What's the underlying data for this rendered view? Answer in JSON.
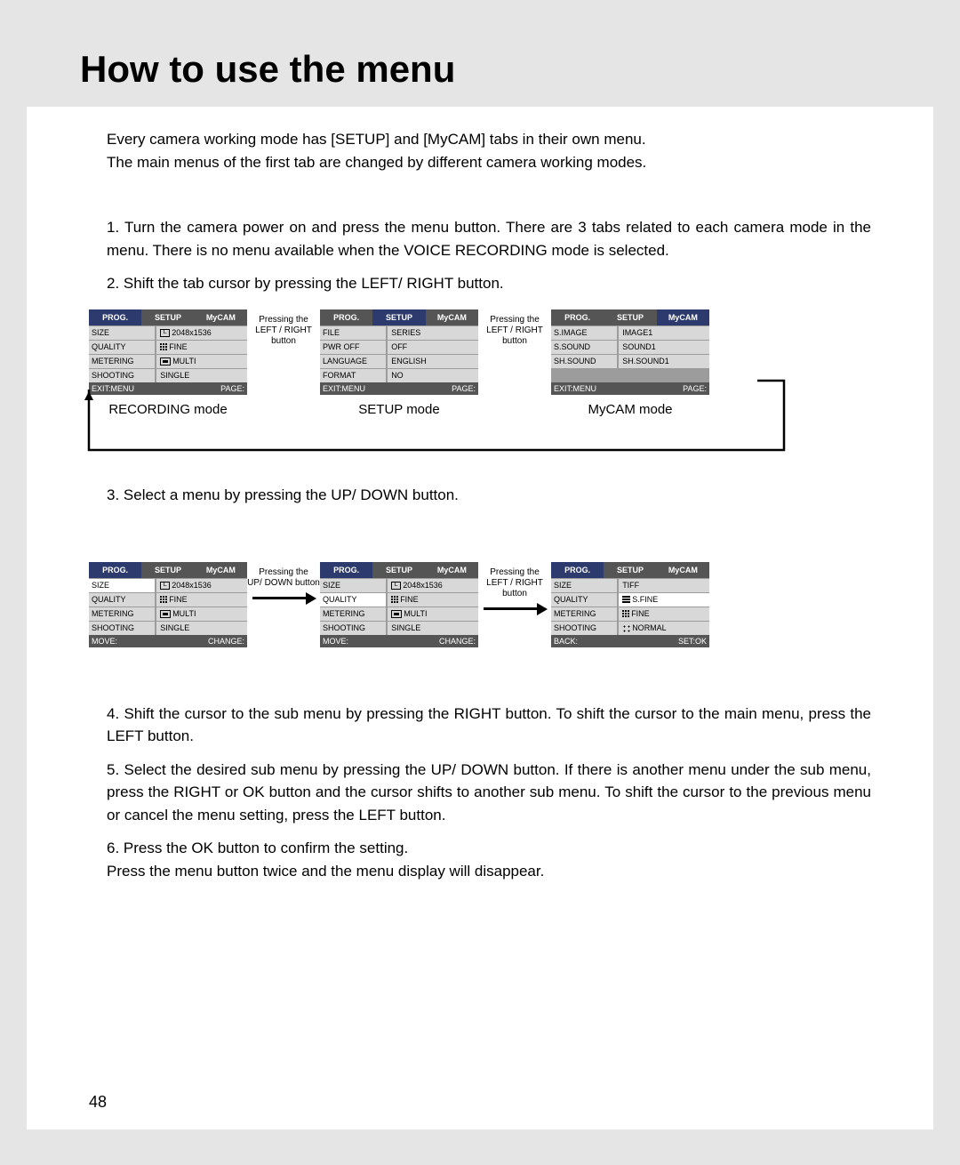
{
  "page_number": "48",
  "title": "How to use the menu",
  "intro": {
    "line1": "Every camera working mode has [SETUP] and [MyCAM] tabs in their own menu.",
    "line2": "The main menus of the first tab are changed by different camera working modes."
  },
  "steps": {
    "s1": "1. Turn the camera power on and press the menu button. There are 3 tabs related to each camera mode in the menu. There is no menu available when the VOICE RECORDING mode is selected.",
    "s2": "2. Shift the tab cursor by pressing the LEFT/ RIGHT button.",
    "s3": "3. Select a menu by pressing the UP/ DOWN button.",
    "s4": "4. Shift the cursor to the sub menu by pressing the RIGHT button. To shift the cursor to the main menu, press the LEFT button.",
    "s5": "5. Select the desired sub menu by pressing the UP/ DOWN button. If there is another menu under the sub menu, press the RIGHT or OK button and the cursor shifts to another sub menu. To shift the cursor to the previous menu or cancel the menu setting, press the LEFT button.",
    "s6": "6. Press the OK button to confirm the setting.",
    "s6b": "Press the menu button twice and the menu display will disappear."
  },
  "connectors": {
    "lr_press": "Pressing the",
    "lr_button": "LEFT / RIGHT button",
    "ud_press": "Pressing the",
    "ud_button": "UP/ DOWN button"
  },
  "tabs": {
    "prog": "PROG.",
    "setup": "SETUP",
    "mycam": "MyCAM"
  },
  "captions": {
    "recording": "RECORDING mode",
    "setup": "SETUP mode",
    "mycam": "MyCAM mode"
  },
  "screens": {
    "rec": {
      "rows": [
        {
          "label": "SIZE",
          "value": "2048x1536",
          "iconL": "L"
        },
        {
          "label": "QUALITY",
          "value": "FINE",
          "iconGrid": true
        },
        {
          "label": "METERING",
          "value": "MULTI",
          "iconRect": true
        },
        {
          "label": "SHOOTING",
          "value": "SINGLE"
        }
      ],
      "fl": "EXIT:MENU",
      "fr": "PAGE:"
    },
    "setup": {
      "rows": [
        {
          "label": "FILE",
          "value": "SERIES"
        },
        {
          "label": "PWR OFF",
          "value": "OFF"
        },
        {
          "label": "LANGUAGE",
          "value": "ENGLISH"
        },
        {
          "label": "FORMAT",
          "value": "NO"
        }
      ],
      "fl": "EXIT:MENU",
      "fr": "PAGE:"
    },
    "mycam": {
      "rows": [
        {
          "label": "S.IMAGE",
          "value": "IMAGE1"
        },
        {
          "label": "S.SOUND",
          "value": "SOUND1"
        },
        {
          "label": "SH.SOUND",
          "value": "SH.SOUND1"
        }
      ],
      "fl": "EXIT:MENU",
      "fr": "PAGE:"
    },
    "sel1": {
      "rows": [
        {
          "label": "SIZE",
          "value": "2048x1536",
          "iconL": "L",
          "hlLabel": true
        },
        {
          "label": "QUALITY",
          "value": "FINE",
          "iconGrid": true
        },
        {
          "label": "METERING",
          "value": "MULTI",
          "iconRect": true
        },
        {
          "label": "SHOOTING",
          "value": "SINGLE"
        }
      ],
      "fl": "MOVE:",
      "fr": "CHANGE:"
    },
    "sel2": {
      "rows": [
        {
          "label": "SIZE",
          "value": "2048x1536",
          "iconL": "L"
        },
        {
          "label": "QUALITY",
          "value": "FINE",
          "iconGrid": true,
          "hlLabel": true
        },
        {
          "label": "METERING",
          "value": "MULTI",
          "iconRect": true
        },
        {
          "label": "SHOOTING",
          "value": "SINGLE"
        }
      ],
      "fl": "MOVE:",
      "fr": "CHANGE:"
    },
    "sel3": {
      "rows": [
        {
          "label": "SIZE",
          "value": "TIFF"
        },
        {
          "label": "QUALITY",
          "value": "S.FINE",
          "iconBars": true,
          "hlValue": true
        },
        {
          "label": "METERING",
          "value": "FINE",
          "iconGrid": true
        },
        {
          "label": "SHOOTING",
          "value": "NORMAL",
          "iconDots": true
        }
      ],
      "fl": "BACK:",
      "fr": "SET:OK"
    }
  }
}
